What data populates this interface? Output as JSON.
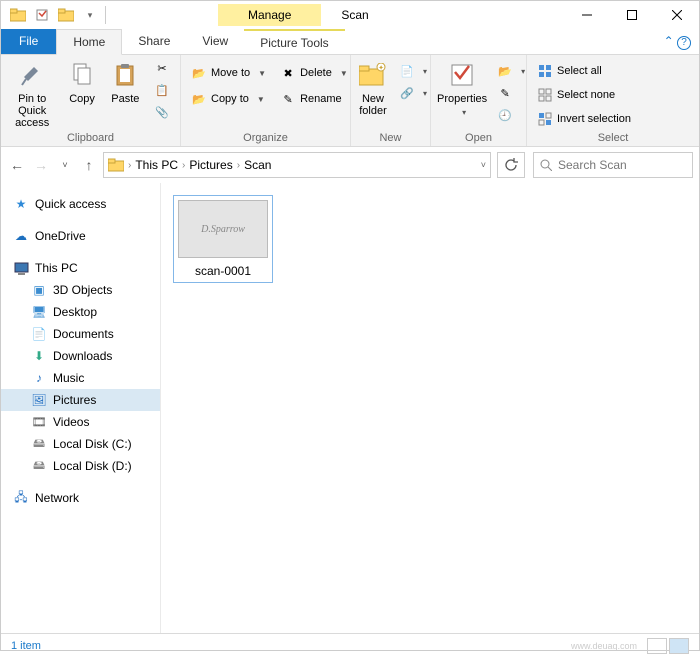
{
  "window": {
    "title": "Scan",
    "contextual_tab_header": "Manage",
    "contextual_tab": "Picture Tools"
  },
  "tabs": {
    "file": "File",
    "home": "Home",
    "share": "Share",
    "view": "View"
  },
  "ribbon": {
    "clipboard": {
      "label": "Clipboard",
      "pin": "Pin to Quick access",
      "copy": "Copy",
      "paste": "Paste"
    },
    "organize": {
      "label": "Organize",
      "moveto": "Move to",
      "copyto": "Copy to",
      "delete": "Delete",
      "rename": "Rename"
    },
    "new": {
      "label": "New",
      "newfolder": "New folder"
    },
    "open": {
      "label": "Open",
      "properties": "Properties"
    },
    "select": {
      "label": "Select",
      "all": "Select all",
      "none": "Select none",
      "invert": "Invert selection"
    }
  },
  "breadcrumbs": [
    "This PC",
    "Pictures",
    "Scan"
  ],
  "search": {
    "placeholder": "Search Scan"
  },
  "sidebar": {
    "quick": "Quick access",
    "onedrive": "OneDrive",
    "thispc": "This PC",
    "items": [
      "3D Objects",
      "Desktop",
      "Documents",
      "Downloads",
      "Music",
      "Pictures",
      "Videos",
      "Local Disk (C:)",
      "Local Disk (D:)"
    ],
    "network": "Network"
  },
  "files": [
    {
      "name": "scan-0001"
    }
  ],
  "status": {
    "count": "1 item"
  }
}
